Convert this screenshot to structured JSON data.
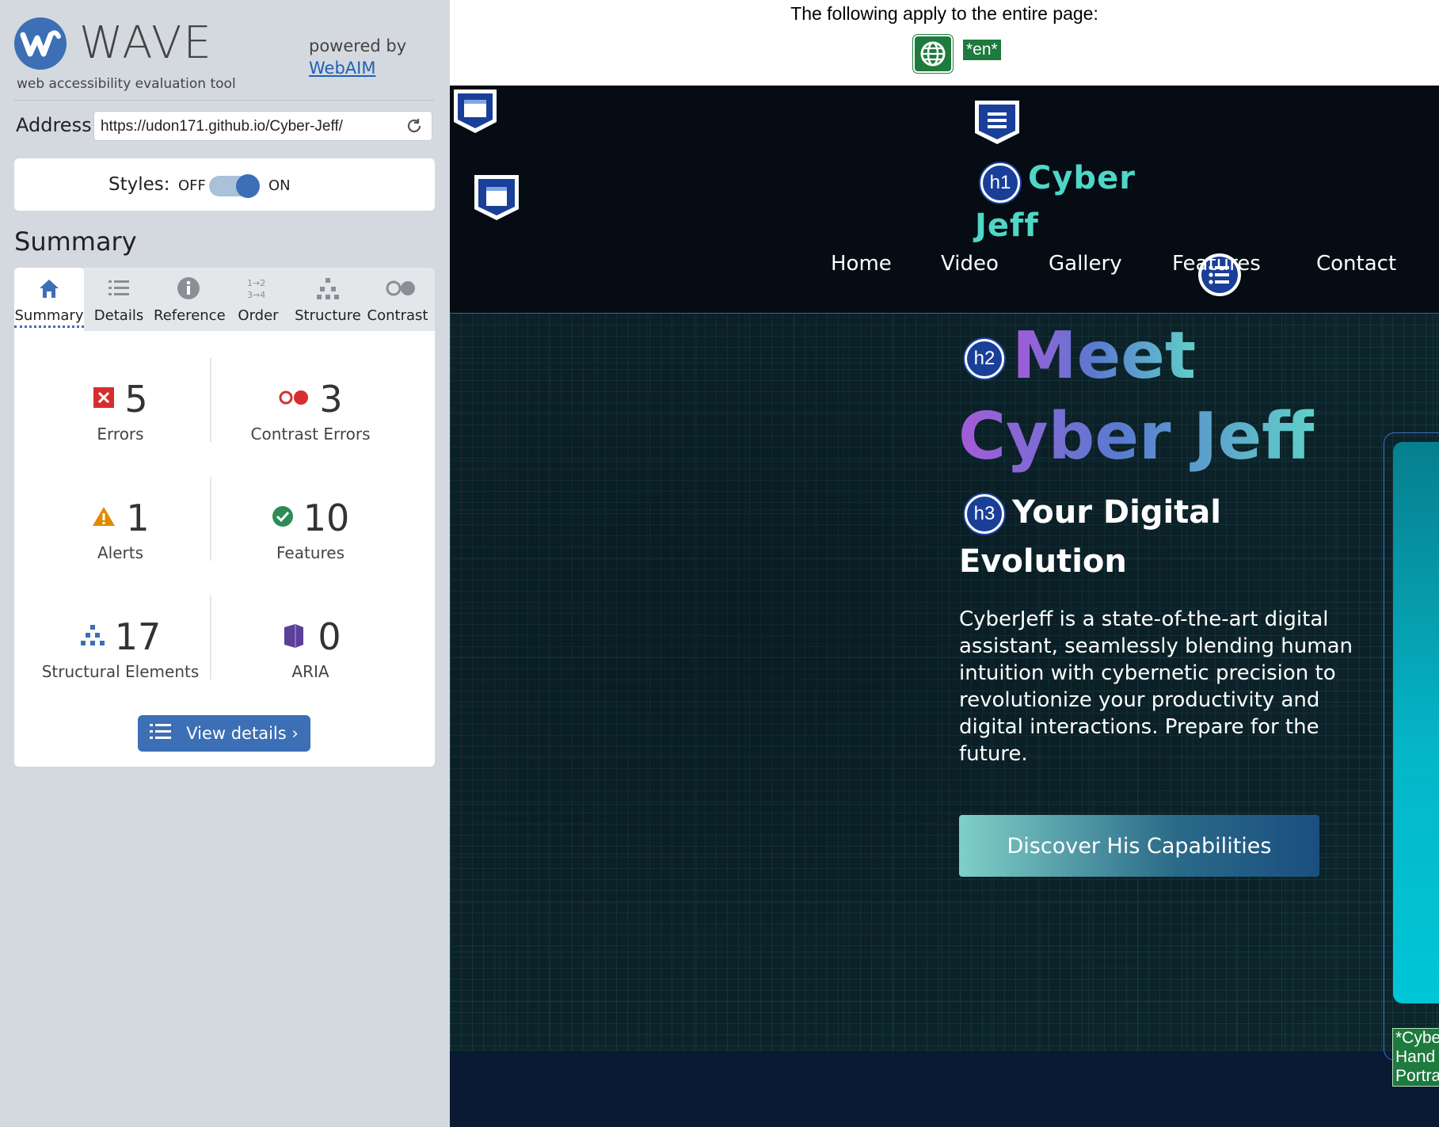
{
  "wave": {
    "logo_text": "WAVE",
    "subtitle": "web accessibility evaluation tool",
    "powered_by": "powered by",
    "webaim_link": "WebAIM",
    "address_label": "Address:",
    "address_value": "https://udon171.github.io/Cyber-Jeff/",
    "styles_label": "Styles:",
    "styles_off": "OFF",
    "styles_on": "ON",
    "styles_state": "on",
    "summary_heading": "Summary",
    "tabs": [
      {
        "label": "Summary",
        "icon": "home-icon",
        "active": true
      },
      {
        "label": "Details",
        "icon": "list-icon",
        "active": false
      },
      {
        "label": "Reference",
        "icon": "info-icon",
        "active": false
      },
      {
        "label": "Order",
        "icon": "order-icon",
        "active": false
      },
      {
        "label": "Structure",
        "icon": "structure-icon",
        "active": false
      },
      {
        "label": "Contrast",
        "icon": "contrast-icon",
        "active": false
      }
    ],
    "stats": [
      {
        "count": "5",
        "label": "Errors",
        "icon": "error-icon",
        "color": "#d62e2e"
      },
      {
        "count": "3",
        "label": "Contrast Errors",
        "icon": "contrast-error-icon",
        "color": "#d62e2e"
      },
      {
        "count": "1",
        "label": "Alerts",
        "icon": "alert-icon",
        "color": "#e08a00"
      },
      {
        "count": "10",
        "label": "Features",
        "icon": "feature-icon",
        "color": "#2e8b57"
      },
      {
        "count": "17",
        "label": "Structural Elements",
        "icon": "structure-icon",
        "color": "#3c6fb5"
      },
      {
        "count": "0",
        "label": "ARIA",
        "icon": "aria-icon",
        "color": "#5b3f99"
      }
    ],
    "view_details": "View details ›",
    "accent_color": "#3c6fb5"
  },
  "page": {
    "apply_text": "The following apply to the entire page:",
    "lang_tag": "*en*",
    "brand_line1": "Cyber",
    "brand_line2": "Jeff",
    "h1_badge": "h1",
    "h2_badge": "h2",
    "h3_badge": "h3",
    "nav": [
      "Home",
      "Video",
      "Gallery",
      "Features",
      "Contact"
    ],
    "hero_title_line1": "Meet",
    "hero_title_line2": "Cyber Jeff",
    "hero_subtitle_line1": "Your Digital",
    "hero_subtitle_line2": "Evolution",
    "hero_paragraph": "CyberJeff is a state-of-the-art digital assistant, seamlessly blending human intuition with cybernetic precision to revolutionize your productivity and digital interactions. Prepare for the future.",
    "cta_label": "Discover His Capabilities",
    "image_alt": "*Cyber Hand Portrait*"
  }
}
